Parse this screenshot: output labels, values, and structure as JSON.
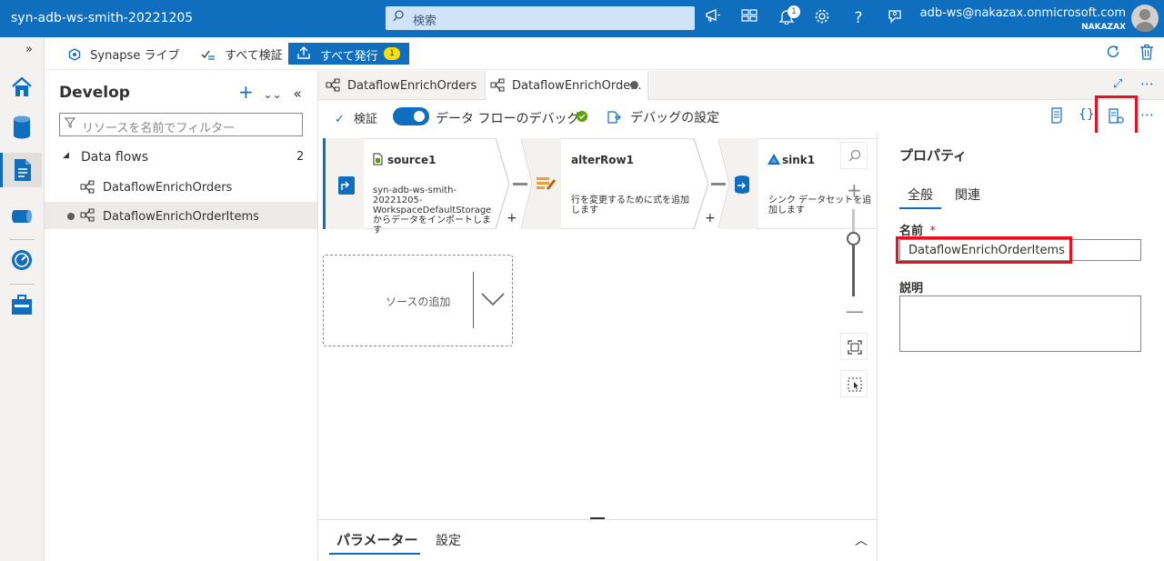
{
  "topbar": {
    "workspace": "syn-adb-ws-smith-20221205",
    "search_placeholder": "検索",
    "notification_count": "1",
    "user_email": "adb-ws@nakazax.onmicrosoft.com",
    "user_tenant": "NAKAZAX",
    "icons": [
      "megaphone-icon",
      "directory-icon",
      "bell-icon",
      "gear-icon",
      "help-icon",
      "feedback-icon"
    ]
  },
  "toolbar": {
    "synapse_live": "Synapse ライブ",
    "validate_all": "すべて検証",
    "publish_all": "すべて発行",
    "publish_count": "1"
  },
  "develop": {
    "title": "Develop",
    "filter_placeholder": "リソースを名前でフィルター",
    "section_label": "Data flows",
    "section_count": "2",
    "items": [
      {
        "label": "DataflowEnrichOrders",
        "modified": false
      },
      {
        "label": "DataflowEnrichOrderItems",
        "modified": true
      }
    ]
  },
  "tabs": [
    {
      "label": "DataflowEnrichOrders",
      "active": false
    },
    {
      "label": "DataflowEnrichOrde...",
      "active": true
    }
  ],
  "dataflow_toolbar": {
    "validate": "検証",
    "debug_label": "データ フローのデバッグ",
    "debug_enabled": true,
    "debug_settings": "デバッグの設定"
  },
  "canvas": {
    "nodes": [
      {
        "title": "source1",
        "desc": "syn-adb-ws-smith-20221205-WorkspaceDefaultStorage からデータをインポートします"
      },
      {
        "title": "alterRow1",
        "desc": "行を変更するために式を追加します"
      },
      {
        "title": "sink1",
        "desc": "シンク データセットを追加します"
      }
    ],
    "add_source": "ソースの追加"
  },
  "bottom_tabs": [
    "パラメーター",
    "設定"
  ],
  "properties": {
    "title": "プロパティ",
    "tabs": [
      "全般",
      "関連"
    ],
    "name_label": "名前",
    "required_mark": "*",
    "name_value": "DataflowEnrichOrderItems",
    "description_label": "説明",
    "description_value": ""
  },
  "colors": {
    "brand": "#106ebe",
    "highlight": "#e81123",
    "badge": "#fce100",
    "debug_ok": "#57a300"
  }
}
